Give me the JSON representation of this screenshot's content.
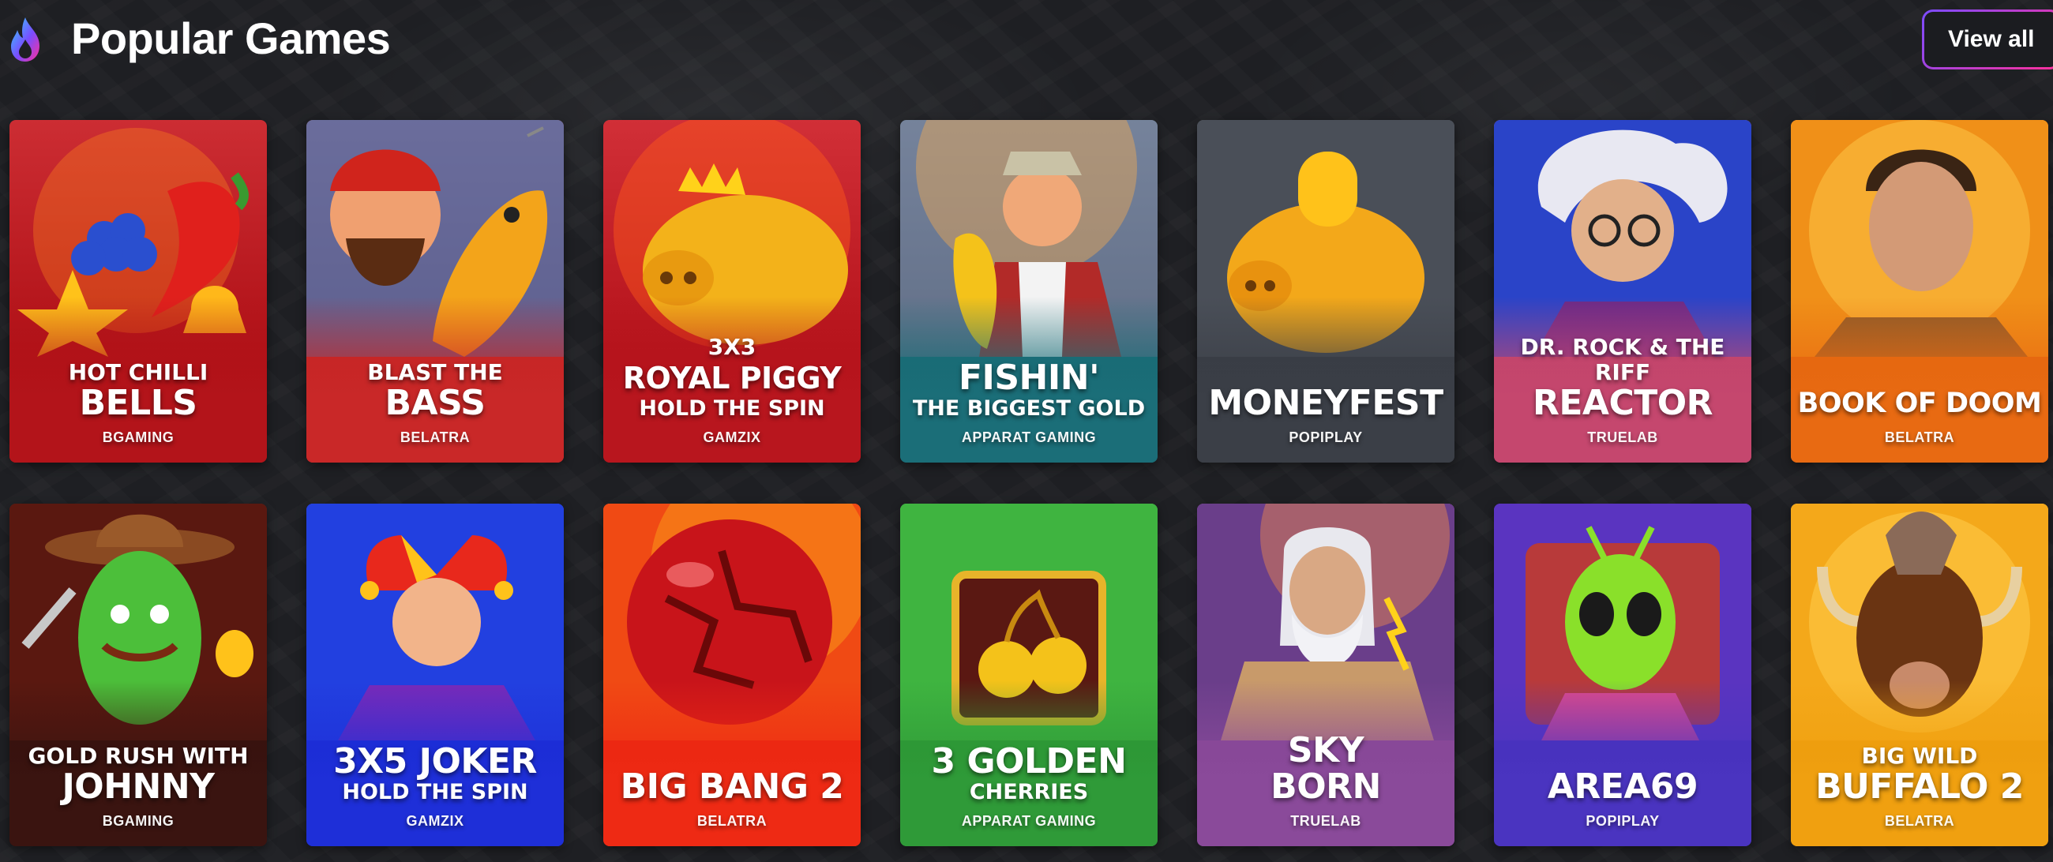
{
  "header": {
    "title": "Popular Games",
    "view_all_label": "View all",
    "icon": "flame-icon"
  },
  "games": [
    {
      "id": "hot-chilli-bells",
      "line1": "HOT CHILLI",
      "line2": "BELLS",
      "line3": "",
      "provider": "BGAMING",
      "color": "#b3141a",
      "art": "chilli-bells"
    },
    {
      "id": "blast-the-bass",
      "line1": "BLAST THE",
      "line2": "BASS",
      "line3": "",
      "provider": "BELATRA",
      "color": "#c92828",
      "art": "fisherman-fish"
    },
    {
      "id": "royal-piggy",
      "line1": "3X3",
      "line2": "ROYAL PIGGY",
      "line3": "HOLD THE SPIN",
      "provider": "GAMZIX",
      "color": "#b8161e",
      "art": "gold-pig-crown"
    },
    {
      "id": "fishin",
      "line1": "",
      "line2": "FISHIN'",
      "line3": "THE BIGGEST GOLD",
      "provider": "APPARAT GAMING",
      "color": "#1b6e78",
      "art": "fisherman-gold-fish"
    },
    {
      "id": "moneyfest",
      "line1": "",
      "line2": "MONEYFEST",
      "line3": "",
      "provider": "POPIPLAY",
      "color": "#3b3f47",
      "art": "piggy-bank-coin"
    },
    {
      "id": "reactor",
      "line1": "DR. ROCK & THE RIFF",
      "line2": "REACTOR",
      "line3": "",
      "provider": "TRUELAB",
      "color": "#c5476e",
      "art": "mad-scientist"
    },
    {
      "id": "book-of-doom",
      "line1": "",
      "line2": "BOOK OF DOOM",
      "line3": "",
      "provider": "BELATRA",
      "color": "#e86a12",
      "art": "adventurer"
    },
    {
      "id": "gold-rush-johnny",
      "line1": "GOLD RUSH WITH",
      "line2": "JOHNNY",
      "line3": "",
      "provider": "BGAMING",
      "color": "#3a1410",
      "art": "cactus-cowboy"
    },
    {
      "id": "joker-3x5",
      "line1": "",
      "line2": "3X5 JOKER",
      "line3": "HOLD THE SPIN",
      "provider": "GAMZIX",
      "color": "#1e2fd8",
      "art": "jester"
    },
    {
      "id": "big-bang-2",
      "line1": "",
      "line2": "BIG BANG 2",
      "line3": "",
      "provider": "BELATRA",
      "color": "#ee2a14",
      "art": "red-planet"
    },
    {
      "id": "golden-cherries",
      "line1": "",
      "line2": "3 GOLDEN",
      "line3": "CHERRIES",
      "provider": "APPARAT GAMING",
      "color": "#2f9a38",
      "art": "golden-cherry"
    },
    {
      "id": "sky-born",
      "line1": "",
      "line2": "SKY\nBORN",
      "line3": "",
      "provider": "TRUELAB",
      "color": "#8a4a9a",
      "art": "zeus"
    },
    {
      "id": "area69",
      "line1": "",
      "line2": "AREA69",
      "line3": "",
      "provider": "POPIPLAY",
      "color": "#4a34c0",
      "art": "alien"
    },
    {
      "id": "big-wild-buffalo-2",
      "line1": "BIG WILD",
      "line2": "BUFFALO 2",
      "line3": "",
      "provider": "BELATRA",
      "color": "#f0a010",
      "art": "buffalo"
    }
  ]
}
